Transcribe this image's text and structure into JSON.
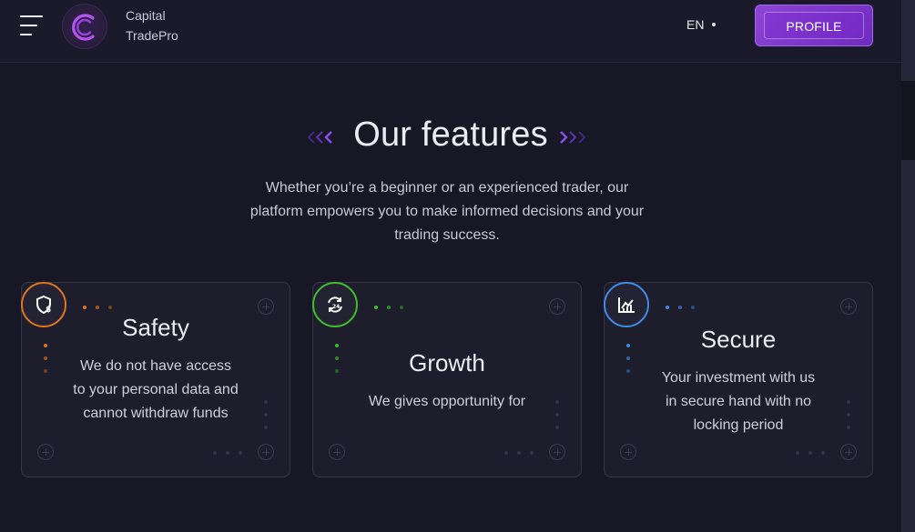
{
  "header": {
    "brand_line1": "Capital",
    "brand_line2": "TradePro",
    "language": "EN",
    "profile_label": "PROFILE"
  },
  "features": {
    "title": "Our features",
    "subtitle": "Whether you’re a beginner or an experienced trader, our platform empowers you to make informed decisions and your trading success.",
    "cards": [
      {
        "title": "Safety",
        "description": "We do not have access to your personal data and cannot withdraw funds",
        "icon": "shield-dollar-icon",
        "accent": "#e0731f"
      },
      {
        "title": "Growth",
        "description": "We gives opportunity for",
        "icon": "refresh-24-icon",
        "accent": "#3cc02a"
      },
      {
        "title": "Secure",
        "description": "Your investment with us in secure hand with no locking period",
        "icon": "chart-icon",
        "accent": "#3f8be8"
      }
    ]
  },
  "colors": {
    "background": "#171726",
    "accent_purple": "#8b44d6",
    "card_border": "#363648"
  }
}
